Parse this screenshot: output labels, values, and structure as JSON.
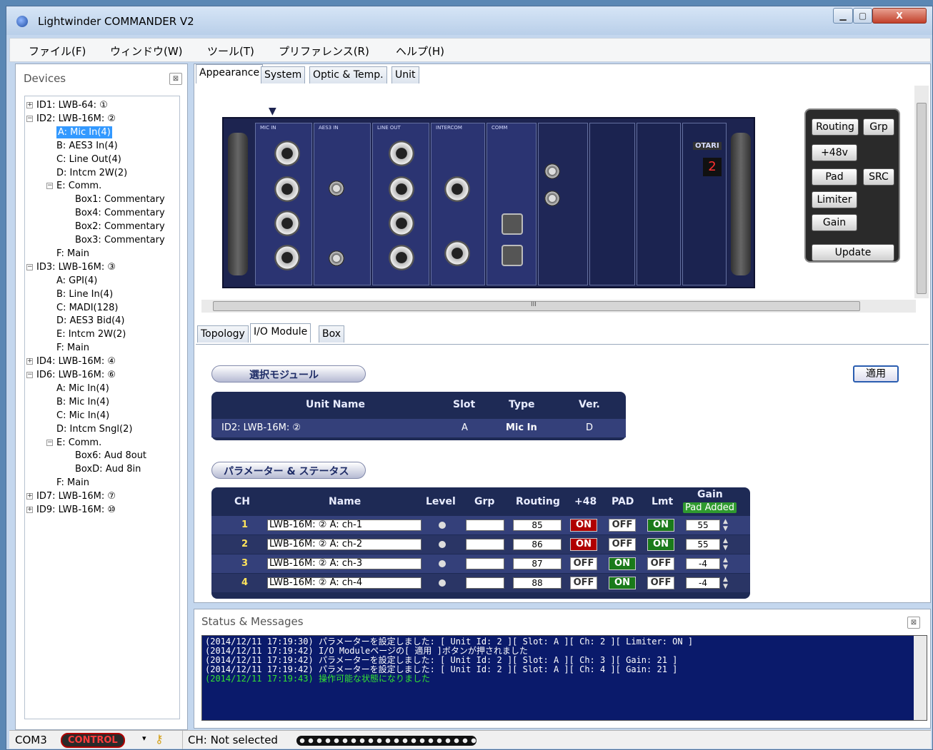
{
  "window": {
    "title": "Lightwinder COMMANDER V2",
    "min": "▁",
    "max": "▢",
    "close": "X"
  },
  "menu": [
    "ファイル(F)",
    "ウィンドウ(W)",
    "ツール(T)",
    "プリファレンス(R)",
    "ヘルプ(H)"
  ],
  "devices": {
    "title": "Devices",
    "close": "⊠",
    "tree": [
      {
        "label": "ID1: LWB-64: ①",
        "level": 0,
        "exp": "+"
      },
      {
        "label": "ID2: LWB-16M: ②",
        "level": 0,
        "exp": "−"
      },
      {
        "label": "A: Mic In(4)",
        "level": 1,
        "selected": true
      },
      {
        "label": "B: AES3 In(4)",
        "level": 1
      },
      {
        "label": "C: Line Out(4)",
        "level": 1
      },
      {
        "label": "D: Intcm 2W(2)",
        "level": 1
      },
      {
        "label": "E: Comm.",
        "level": 1,
        "exp": "−"
      },
      {
        "label": "Box1: Commentary",
        "level": 2
      },
      {
        "label": "Box4: Commentary",
        "level": 2
      },
      {
        "label": "Box2: Commentary",
        "level": 2
      },
      {
        "label": "Box3: Commentary",
        "level": 2
      },
      {
        "label": "F: Main",
        "level": 1
      },
      {
        "label": "ID3: LWB-16M: ③",
        "level": 0,
        "exp": "−"
      },
      {
        "label": "A: GPI(4)",
        "level": 1
      },
      {
        "label": "B: Line In(4)",
        "level": 1
      },
      {
        "label": "C: MADI(128)",
        "level": 1
      },
      {
        "label": "D: AES3 Bid(4)",
        "level": 1
      },
      {
        "label": "E: Intcm 2W(2)",
        "level": 1
      },
      {
        "label": "F: Main",
        "level": 1
      },
      {
        "label": "ID4: LWB-16M: ④",
        "level": 0,
        "exp": "+"
      },
      {
        "label": "ID6: LWB-16M: ⑥",
        "level": 0,
        "exp": "−"
      },
      {
        "label": "A: Mic In(4)",
        "level": 1
      },
      {
        "label": "B: Mic In(4)",
        "level": 1
      },
      {
        "label": "C: Mic In(4)",
        "level": 1
      },
      {
        "label": "D: Intcm Sngl(2)",
        "level": 1
      },
      {
        "label": "E: Comm.",
        "level": 1,
        "exp": "−"
      },
      {
        "label": "Box6: Aud 8out",
        "level": 2
      },
      {
        "label": "BoxD: Aud 8in",
        "level": 2
      },
      {
        "label": "F: Main",
        "level": 1
      },
      {
        "label": "ID7: LWB-16M: ⑦",
        "level": 0,
        "exp": "+"
      },
      {
        "label": "ID9: LWB-16M: ⑩",
        "level": 0,
        "exp": "+"
      }
    ]
  },
  "top_tabs": [
    "Appearance",
    "System",
    "Optic & Temp.",
    "Unit"
  ],
  "rack": {
    "arrow": "▼",
    "cards": [
      "MIC IN",
      "AES3 IN",
      "LINE OUT",
      "INTERCOM",
      "COMM"
    ],
    "brand": "OTARI",
    "display": "2",
    "buttons": {
      "routing": "Routing",
      "grp": "Grp",
      "p48": "+48v",
      "pad": "Pad",
      "src": "SRC",
      "limiter": "Limiter",
      "gain": "Gain",
      "update": "Update"
    }
  },
  "hscroll_grip": "III",
  "bottom_tabs": [
    "Topology",
    "I/O Module",
    "Box"
  ],
  "io": {
    "selected_module_label": "選択モジュール",
    "apply": "適用",
    "unit_headers": [
      "Unit Name",
      "Slot",
      "Type",
      "Ver."
    ],
    "unit_row": {
      "name": "ID2: LWB-16M: ②",
      "slot": "A",
      "type": "Mic In",
      "ver": "D"
    },
    "params_label": "パラメーター & ステータス",
    "param_headers": {
      "ch": "CH",
      "name": "Name",
      "level": "Level",
      "grp": "Grp",
      "routing": "Routing",
      "p48": "+48",
      "pad": "PAD",
      "lmt": "Lmt",
      "gain": "Gain",
      "pad_added": "Pad Added"
    },
    "channels": [
      {
        "ch": "1",
        "name": "LWB-16M: ② A: ch-1",
        "routing": "85",
        "p48": "ON",
        "pad": "OFF",
        "lmt": "ON",
        "gain": "55"
      },
      {
        "ch": "2",
        "name": "LWB-16M: ② A: ch-2",
        "routing": "86",
        "p48": "ON",
        "pad": "OFF",
        "lmt": "ON",
        "gain": "55"
      },
      {
        "ch": "3",
        "name": "LWB-16M: ② A: ch-3",
        "routing": "87",
        "p48": "OFF",
        "pad": "ON",
        "lmt": "OFF",
        "gain": "-4"
      },
      {
        "ch": "4",
        "name": "LWB-16M: ② A: ch-4",
        "routing": "88",
        "p48": "OFF",
        "pad": "ON",
        "lmt": "OFF",
        "gain": "-4"
      }
    ]
  },
  "status": {
    "title": "Status & Messages",
    "close": "⊠",
    "log": [
      {
        "text": "(2014/12/11 17:19:30) パラメーターを設定しました: [ Unit Id: 2 ][ Slot: A ][ Ch: 2 ][ Limiter: ON ]",
        "color": "#ffffff"
      },
      {
        "text": "(2014/12/11 17:19:42) I/O Moduleページの[ 適用 ]ボタンが押されました",
        "color": "#ffffff"
      },
      {
        "text": "(2014/12/11 17:19:42) パラメーターを設定しました: [ Unit Id: 2 ][ Slot: A ][ Ch: 3 ][ Gain: 21 ]",
        "color": "#ffffff"
      },
      {
        "text": "(2014/12/11 17:19:42) パラメーターを設定しました: [ Unit Id: 2 ][ Slot: A ][ Ch: 4 ][ Gain: 21 ]",
        "color": "#ffffff"
      },
      {
        "text": "(2014/12/11 17:19:43) 操作可能な状態になりました",
        "color": "#33e233"
      }
    ]
  },
  "statusbar": {
    "port": "COM3",
    "control": "CONTROL",
    "ch": "CH: Not selected"
  }
}
